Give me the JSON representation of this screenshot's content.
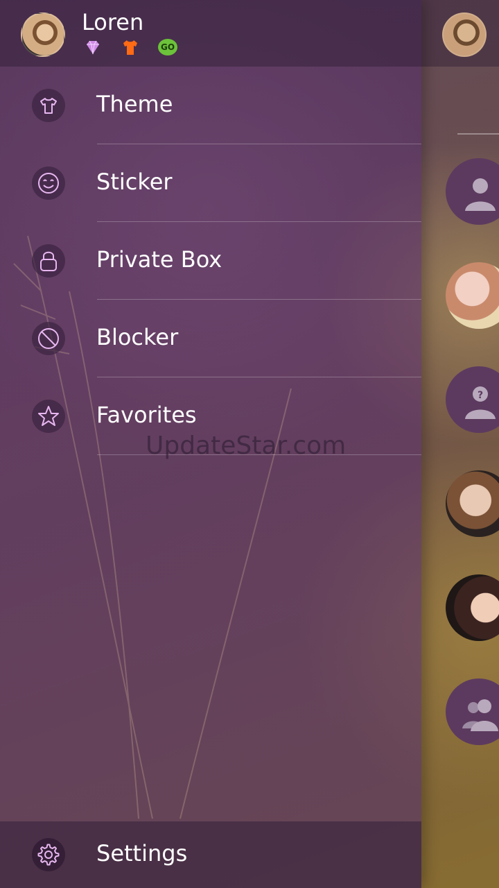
{
  "profile": {
    "name": "Loren",
    "badges": [
      {
        "icon": "diamond-icon",
        "color": "#d08be6"
      },
      {
        "icon": "tshirt-icon",
        "color": "#ff6a14"
      },
      {
        "icon": "go-icon",
        "text": "GO",
        "color": "#6cc23a"
      }
    ]
  },
  "menu": {
    "items": [
      {
        "label": "Theme",
        "icon": "tshirt-icon"
      },
      {
        "label": "Sticker",
        "icon": "smiley-icon"
      },
      {
        "label": "Private Box",
        "icon": "lock-icon"
      },
      {
        "label": "Blocker",
        "icon": "block-icon"
      },
      {
        "label": "Favorites",
        "icon": "star-icon"
      }
    ]
  },
  "footer": {
    "settings_label": "Settings",
    "settings_icon": "gear-icon"
  },
  "watermark": "UpdateStar.com",
  "colors": {
    "accent_icon": "#e7b7f0",
    "drawer": "#5a375f"
  }
}
